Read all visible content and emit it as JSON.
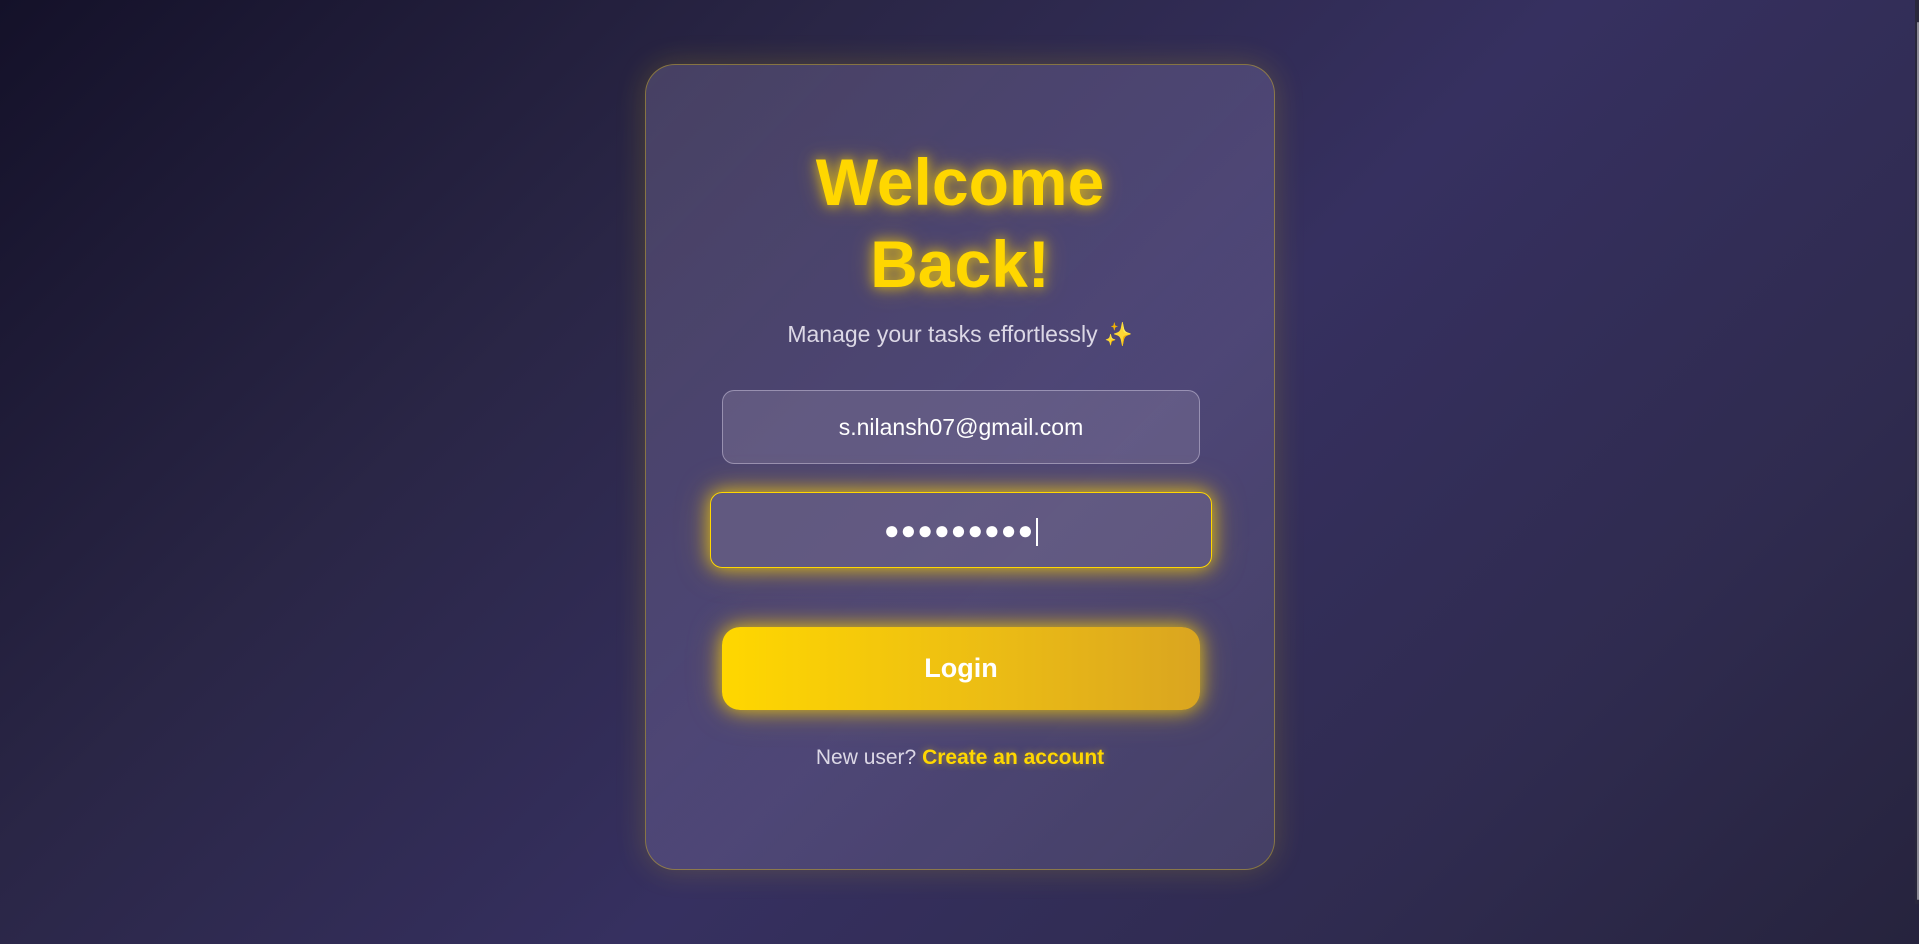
{
  "login": {
    "title_line1": "Welcome",
    "title_line2": "Back!",
    "subtitle": "Manage your tasks effortlessly",
    "subtitle_emoji": "✨",
    "email_value": "s.nilansh07@gmail.com",
    "password_masked": "●●●●●●●●●",
    "login_button": "Login",
    "new_user_text": "New user?",
    "create_account_link": "Create an account"
  },
  "colors": {
    "accent": "#ffd700",
    "accent_dark": "#daa520",
    "background": "#2a2646"
  }
}
